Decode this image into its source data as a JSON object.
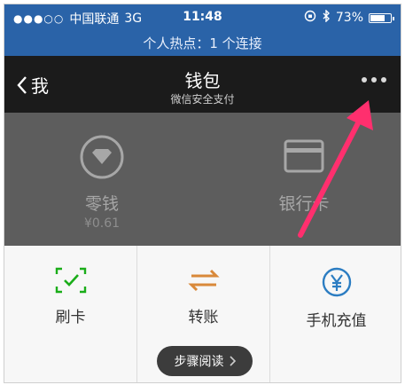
{
  "status_bar": {
    "carrier": "中国联通",
    "network": "3G",
    "time": "11:48",
    "battery": "73%",
    "battery_level": 0.73
  },
  "hotspot": {
    "text": "个人热点：1 个连接"
  },
  "navbar": {
    "back_label": "我",
    "title": "钱包",
    "subtitle": "微信安全支付"
  },
  "wallet": {
    "change_label": "零钱",
    "change_amount": "¥0.61",
    "bank_label": "银行卡"
  },
  "services": [
    {
      "label": "刷卡",
      "icon": "scan-card-icon"
    },
    {
      "label": "转账",
      "icon": "transfer-icon"
    },
    {
      "label": "手机充值",
      "icon": "yen-icon"
    }
  ],
  "bottom_pill": {
    "label": "步骤阅读"
  },
  "colors": {
    "status_bg": "#2a63a8",
    "nav_bg": "#1b1b1b",
    "wallet_bg": "#5d5d5d",
    "arrow": "#ff2f6e",
    "green": "#1aad19",
    "orange": "#d9893a",
    "blue": "#2c7dc2"
  }
}
